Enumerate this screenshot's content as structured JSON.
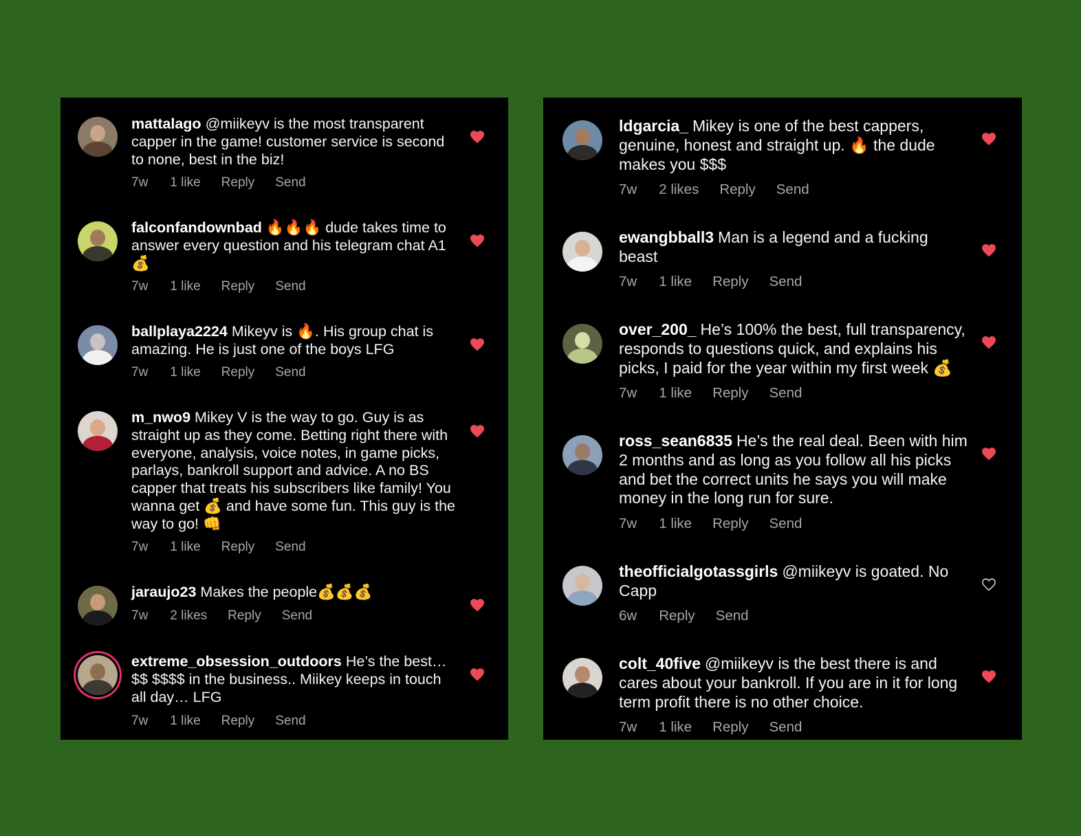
{
  "colors": {
    "background": "#2d641e",
    "panel": "#000000",
    "text": "#f5f5f5",
    "meta": "#a8a8a8",
    "heart_liked": "#ed4956",
    "story_ring": "#e1306c"
  },
  "left_comments": [
    {
      "username": "mattalago",
      "text": "@miikeyv is the most transparent capper in the game! customer service is second to none, best in the biz!",
      "time": "7w",
      "likes": "1 like",
      "reply": "Reply",
      "send": "Send",
      "liked": true,
      "icon": "heart-filled-icon"
    },
    {
      "username": "falconfandownbad",
      "text": "🔥🔥🔥 dude takes time to answer every question and his telegram chat A1 💰",
      "time": "7w",
      "likes": "1 like",
      "reply": "Reply",
      "send": "Send",
      "liked": true,
      "icon": "heart-filled-icon"
    },
    {
      "username": "ballplaya2224",
      "text": "Mikeyv is 🔥. His group chat is amazing. He is just one of the boys LFG",
      "time": "7w",
      "likes": "1 like",
      "reply": "Reply",
      "send": "Send",
      "liked": true,
      "icon": "heart-filled-icon"
    },
    {
      "username": "m_nwo9",
      "text": "Mikey V is the way to go.  Guy is as straight up as they come.  Betting right there with everyone, analysis, voice notes, in game picks, parlays, bankroll support and advice.  A no BS capper that treats his subscribers like family! You wanna get 💰 and have some fun. This guy is the way to go! 👊",
      "time": "7w",
      "likes": "1 like",
      "reply": "Reply",
      "send": "Send",
      "liked": true,
      "icon": "heart-filled-icon"
    },
    {
      "username": "jaraujo23",
      "text": "Makes the people💰💰💰",
      "time": "7w",
      "likes": "2 likes",
      "reply": "Reply",
      "send": "Send",
      "liked": true,
      "icon": "heart-filled-icon"
    },
    {
      "username": "extreme_obsession_outdoors",
      "text": "He’s the best… $$ $$$$ in the business.. Miikey keeps in touch all day… LFG",
      "time": "7w",
      "likes": "1 like",
      "reply": "Reply",
      "send": "Send",
      "liked": true,
      "icon": "heart-filled-icon"
    }
  ],
  "right_comments": [
    {
      "username": "ldgarcia_",
      "text": "Mikey is one of the best cappers, genuine, honest and straight up. 🔥 the dude makes you $$$",
      "time": "7w",
      "likes": "2 likes",
      "reply": "Reply",
      "send": "Send",
      "liked": true,
      "icon": "heart-filled-icon"
    },
    {
      "username": "ewangbball3",
      "text": "Man is a legend and a fucking beast",
      "time": "7w",
      "likes": "1 like",
      "reply": "Reply",
      "send": "Send",
      "liked": true,
      "icon": "heart-filled-icon"
    },
    {
      "username": "over_200_",
      "text": "He’s 100% the best, full transparency, responds to questions quick, and explains his picks, I paid for the year within my first week 💰",
      "time": "7w",
      "likes": "1 like",
      "reply": "Reply",
      "send": "Send",
      "liked": true,
      "icon": "heart-filled-icon"
    },
    {
      "username": "ross_sean6835",
      "text": "He’s the real deal. Been with him 2 months and as long as you follow all his picks and bet the correct units he says you will make money in the long run for sure.",
      "time": "7w",
      "likes": "1 like",
      "reply": "Reply",
      "send": "Send",
      "liked": true,
      "icon": "heart-filled-icon"
    },
    {
      "username": "theofficialgotassgirls",
      "text": "@miikeyv is goated. No Capp",
      "time": "6w",
      "likes": "",
      "reply": "Reply",
      "send": "Send",
      "liked": false,
      "icon": "heart-outline-icon"
    },
    {
      "username": "colt_40five",
      "text": "@miikeyv is the best there is and cares about your bankroll. If you are in it for long term profit there is no other choice.",
      "time": "7w",
      "likes": "1 like",
      "reply": "Reply",
      "send": "Send",
      "liked": true,
      "icon": "heart-filled-icon"
    }
  ]
}
